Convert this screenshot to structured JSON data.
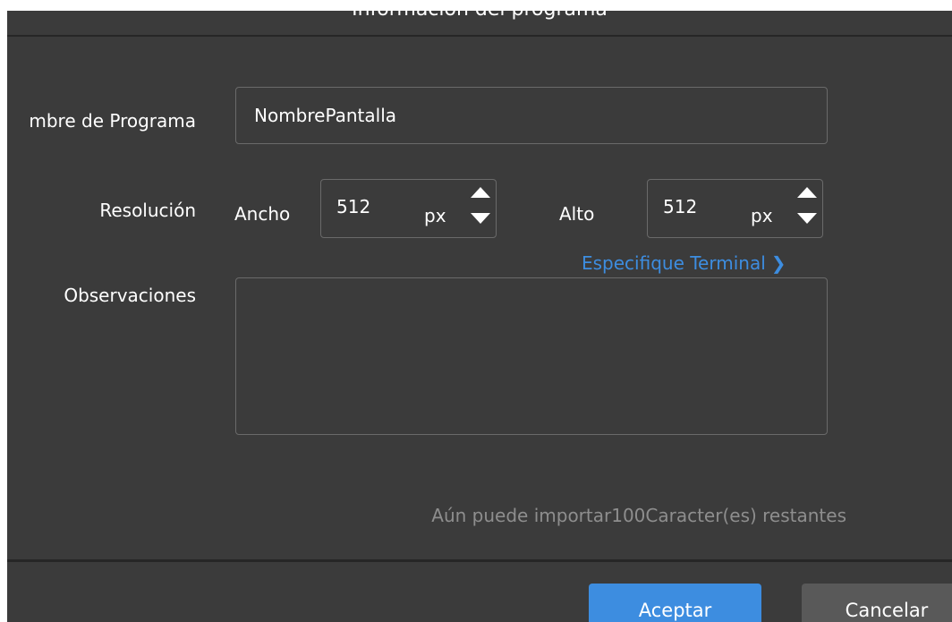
{
  "dialog": {
    "title": "Información del programa"
  },
  "form": {
    "program_name_label": "mbre de Programa",
    "program_name_value": "NombrePantalla",
    "resolution_label": "Resolución",
    "width_label": "Ancho",
    "width_value": "512",
    "width_unit": "px",
    "height_label": "Alto",
    "height_value": "512",
    "height_unit": "px",
    "terminal_link": "Especifique Terminal",
    "terminal_link_icon": "chevron-right-icon",
    "notes_label": "Observaciones",
    "notes_value": "",
    "remaining_text": "Aún puede importar100Caracter(es) restantes"
  },
  "footer": {
    "accept_label": "Aceptar",
    "cancel_label": "Cancelar"
  },
  "colors": {
    "background": "#3b3b3b",
    "accent": "#3d8de0",
    "secondary_button": "#595959",
    "muted_text": "#8e8e8e"
  }
}
